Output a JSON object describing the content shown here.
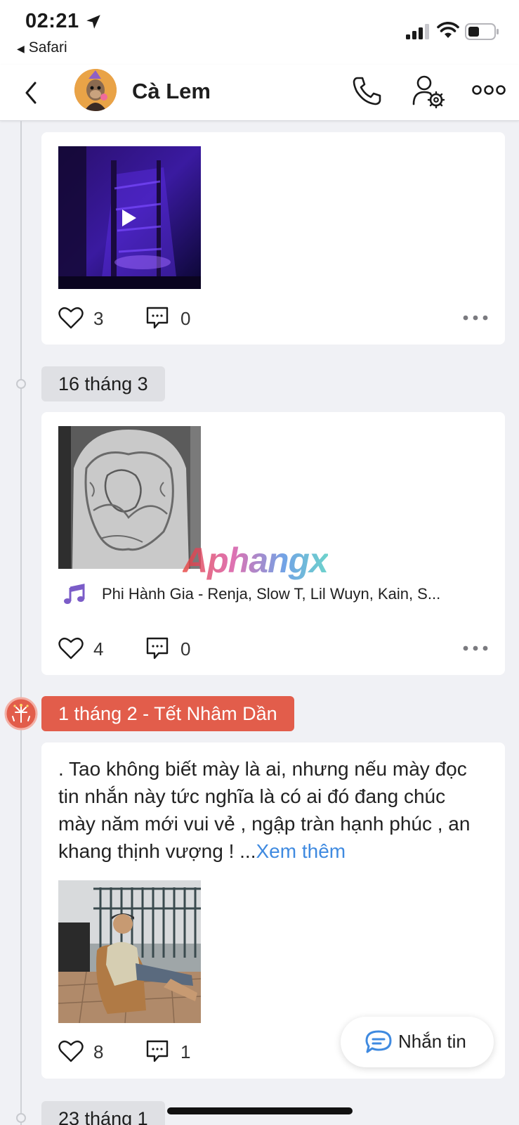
{
  "status_bar": {
    "time": "02:21",
    "back_app_label": "Safari"
  },
  "header": {
    "contact_name": "Cà Lem"
  },
  "posts": [
    {
      "likes": "3",
      "comments": "0"
    },
    {
      "date": "16 tháng 3",
      "music": "Phi Hành Gia - Renja, Slow T, Lil Wuyn, Kain, S...",
      "likes": "4",
      "comments": "0"
    },
    {
      "date": "1 tháng 2 - Tết Nhâm Dần",
      "text": ". Tao không biết mày là ai, nhưng nếu mày đọc tin nhắn này tức nghĩa là có ai đó đang chúc mày năm mới vui vẻ , ngập tràn hạnh phúc , an khang thịnh vượng ! ...",
      "see_more": "Xem thêm",
      "likes": "8",
      "comments": "1"
    }
  ],
  "next_date": "23 tháng 1",
  "watermark": "Aphangx",
  "message_button": {
    "label": "Nhắn tin"
  },
  "colors": {
    "holiday_chip": "#e25d4b",
    "link": "#3f8ae0",
    "background": "#f0f1f5"
  }
}
